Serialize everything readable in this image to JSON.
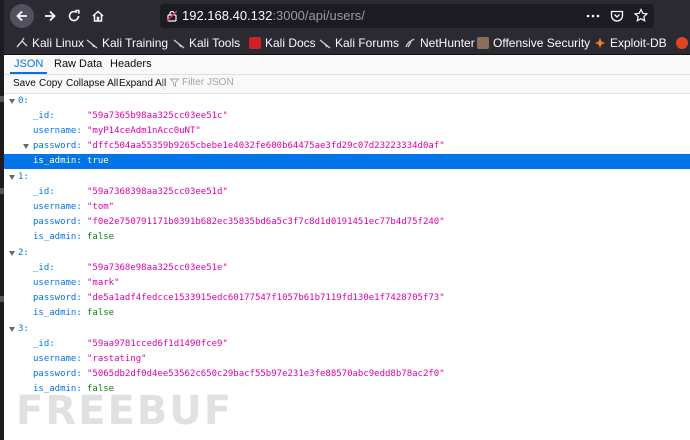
{
  "browser": {
    "url_host": "192.168.40.132",
    "url_rest": ":3000/api/users/"
  },
  "bookmarks": [
    {
      "label": "Kali Linux",
      "icon": "kali-dragon-icon"
    },
    {
      "label": "Kali Training",
      "icon": "kali-dragon-icon"
    },
    {
      "label": "Kali Tools",
      "icon": "kali-dragon-icon"
    },
    {
      "label": "Kali Docs",
      "icon": "kali-docs-icon"
    },
    {
      "label": "Kali Forums",
      "icon": "kali-dragon-icon"
    },
    {
      "label": "NetHunter",
      "icon": "nethunter-icon"
    },
    {
      "label": "Offensive Security",
      "icon": "offsec-icon"
    },
    {
      "label": "Exploit-DB",
      "icon": "exploitdb-icon"
    }
  ],
  "viewer": {
    "tabs": [
      "JSON",
      "Raw Data",
      "Headers"
    ],
    "active_tab": "JSON",
    "toolbar": [
      "Save",
      "Copy",
      "Collapse All",
      "Expand All"
    ],
    "filter_placeholder": "Filter JSON"
  },
  "users": [
    {
      "index": "0:",
      "id": "\"59a7365b98aa325cc03ee51c\"",
      "username": "\"myP14ceAdm1nAcc0uNT\"",
      "password": "\"dffc504aa55359b9265cbebe1e4032fe600b64475ae3fd29c07d23223334d0af\"",
      "is_admin": "true"
    },
    {
      "index": "1:",
      "id": "\"59a7368398aa325cc03ee51d\"",
      "username": "\"tom\"",
      "password": "\"f0e2e750791171b0391b682ec35835bd6a5c3f7c8d1d0191451ec77b4d75f240\"",
      "is_admin": "false"
    },
    {
      "index": "2:",
      "id": "\"59a7368e98aa325cc03ee51e\"",
      "username": "\"mark\"",
      "password": "\"de5a1adf4fedcce1533915edc60177547f1057b61b7119fd130e1f7428705f73\"",
      "is_admin": "false"
    },
    {
      "index": "3:",
      "id": "\"59aa9781cced6f1d1490fce9\"",
      "username": "\"rastating\"",
      "password": "\"5065db2df0d4ee53562c650c29bacf55b97e231e3fe88570abc9edd8b78ac2f0\"",
      "is_admin": "false"
    }
  ],
  "keys": {
    "id": "_id:",
    "username": "username:",
    "password": "password:",
    "is_admin": "is_admin:"
  },
  "colors": {
    "accent": "#0074e8",
    "string": "#dd00a9",
    "boolean": "#058b00",
    "chrome": "#2b2a33"
  },
  "watermark": "FREEBUF"
}
